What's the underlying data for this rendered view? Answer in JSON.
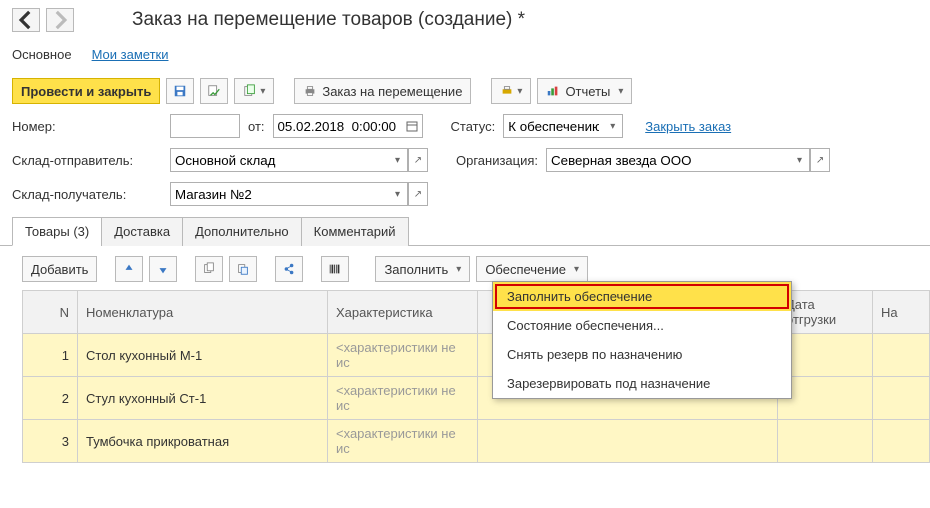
{
  "title": "Заказ на перемещение товаров (создание) *",
  "topTabs": {
    "main": "Основное",
    "notes": "Мои заметки"
  },
  "toolbar": {
    "post_close": "Провести и закрыть",
    "order_move": "Заказ на перемещение",
    "reports": "Отчеты"
  },
  "form": {
    "number_lbl": "Номер:",
    "number_val": "",
    "from_lbl": "от:",
    "date_val": "05.02.2018  0:00:00",
    "status_lbl": "Статус:",
    "status_val": "К обеспечению",
    "close_order": "Закрыть заказ",
    "src_lbl": "Склад-отправитель:",
    "src_val": "Основной склад",
    "org_lbl": "Организация:",
    "org_val": "Северная звезда ООО",
    "dst_lbl": "Склад-получатель:",
    "dst_val": "Магазин №2"
  },
  "tabs2": {
    "goods": "Товары (3)",
    "delivery": "Доставка",
    "extra": "Дополнительно",
    "comment": "Комментарий"
  },
  "grid_toolbar": {
    "add": "Добавить",
    "fill": "Заполнить",
    "provision": "Обеспечение"
  },
  "columns": {
    "n": "N",
    "nomen": "Номенклатура",
    "char": "Характеристика",
    "ship": "Дата отгрузки",
    "last": "На"
  },
  "char_ph": "<характеристики не ис",
  "rows": [
    {
      "n": "1",
      "name": "Стол кухонный М-1"
    },
    {
      "n": "2",
      "name": "Стул кухонный Ст-1"
    },
    {
      "n": "3",
      "name": "Тумбочка прикроватная"
    }
  ],
  "menu": {
    "fill_prov": "Заполнить обеспечение",
    "state": "Состояние обеспечения...",
    "unreserve": "Снять резерв по назначению",
    "reserve": "Зарезервировать под назначение"
  }
}
